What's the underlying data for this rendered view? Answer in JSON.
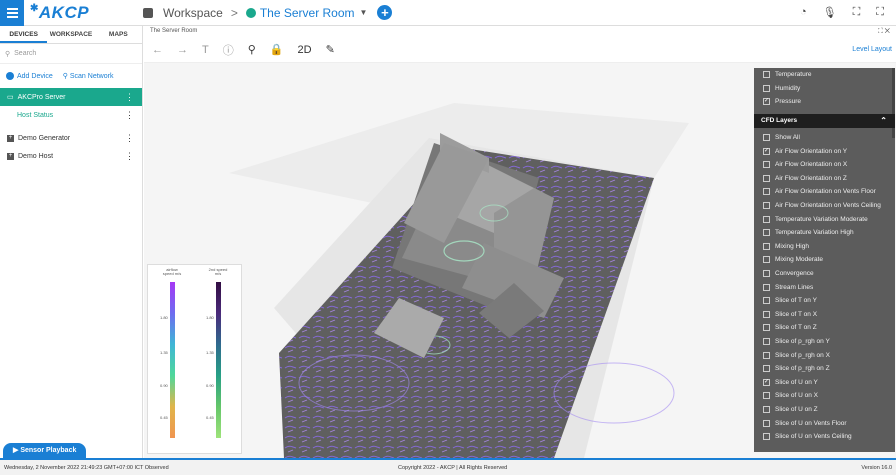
{
  "app": {
    "brand": "AKCP",
    "brand_mark": "✱"
  },
  "breadcrumb": {
    "workspace": "Workspace",
    "separator": ">",
    "room": "The Server Room",
    "caret": "▼",
    "add": "+"
  },
  "top_icons": [
    "◔",
    "🎙",
    "⛶",
    "⛶"
  ],
  "sidebar": {
    "tabs": [
      "DEVICES",
      "WORKSPACE",
      "MAPS"
    ],
    "search_placeholder": "Search",
    "add_device": "Add Device",
    "scan_network": "Scan Network",
    "items": [
      {
        "label": "AKCPro Server",
        "selected": true
      },
      {
        "label": "Host Status",
        "sub": true
      },
      {
        "label": "Demo Generator"
      },
      {
        "label": "Demo Host"
      }
    ],
    "playback": "▶  Sensor Playback"
  },
  "main": {
    "tab_title": "The Server Room",
    "window_icons": "⛶  ✕",
    "toolbar": {
      "back": "←",
      "forward": "→",
      "text": "T",
      "info": "ⓘ",
      "search": "⚲",
      "lock": "🔒",
      "mode": "2D",
      "edit": "✎",
      "level_layout": "Level Layout"
    }
  },
  "legend": {
    "left_title": "airflow speed m/s",
    "right_title": "2nd speed m/s",
    "left_ticks": [
      "1.80",
      "1.35",
      "0.90",
      "0.45"
    ],
    "right_ticks": [
      "1.80",
      "1.35",
      "0.90",
      "0.45"
    ]
  },
  "panel": {
    "top_layers": [
      {
        "label": "Temperature",
        "checked": false
      },
      {
        "label": "Humidity",
        "checked": false
      },
      {
        "label": "Pressure",
        "checked": true
      }
    ],
    "cfd_header": "CFD Layers",
    "cfd_layers": [
      {
        "label": "Show All",
        "checked": false
      },
      {
        "label": "Air Flow Orientation on Y",
        "checked": true
      },
      {
        "label": "Air Flow Orientation on X",
        "checked": false
      },
      {
        "label": "Air Flow Orientation on Z",
        "checked": false
      },
      {
        "label": "Air Flow Orientation on Vents Floor",
        "checked": false
      },
      {
        "label": "Air Flow Orientation on Vents Ceiling",
        "checked": false
      },
      {
        "label": "Temperature Variation Moderate",
        "checked": false
      },
      {
        "label": "Temperature Variation High",
        "checked": false
      },
      {
        "label": "Mixing High",
        "checked": false
      },
      {
        "label": "Mixing Moderate",
        "checked": false
      },
      {
        "label": "Convergence",
        "checked": false
      },
      {
        "label": "Stream Lines",
        "checked": false
      },
      {
        "label": "Slice of T on Y",
        "checked": false
      },
      {
        "label": "Slice of T on X",
        "checked": false
      },
      {
        "label": "Slice of T on Z",
        "checked": false
      },
      {
        "label": "Slice of p_rgh on Y",
        "checked": false
      },
      {
        "label": "Slice of p_rgh on X",
        "checked": false
      },
      {
        "label": "Slice of p_rgh on Z",
        "checked": false
      },
      {
        "label": "Slice of U on Y",
        "checked": true
      },
      {
        "label": "Slice of U on X",
        "checked": false
      },
      {
        "label": "Slice of U on Z",
        "checked": false
      },
      {
        "label": "Slice of U on Vents Floor",
        "checked": false
      },
      {
        "label": "Slice of U on Vents Ceiling",
        "checked": false
      }
    ]
  },
  "footer": {
    "datetime": "Wednesday, 2 November 2022 21:49:23 GMT+07:00 ICT Observed",
    "copyright": "Copyright 2022 - AKCP | All Rights Reserved",
    "version": "Version 16.0"
  },
  "colors": {
    "accent": "#1a7fd4",
    "selected": "#1aa88d",
    "panel": "#5c5c5c"
  }
}
